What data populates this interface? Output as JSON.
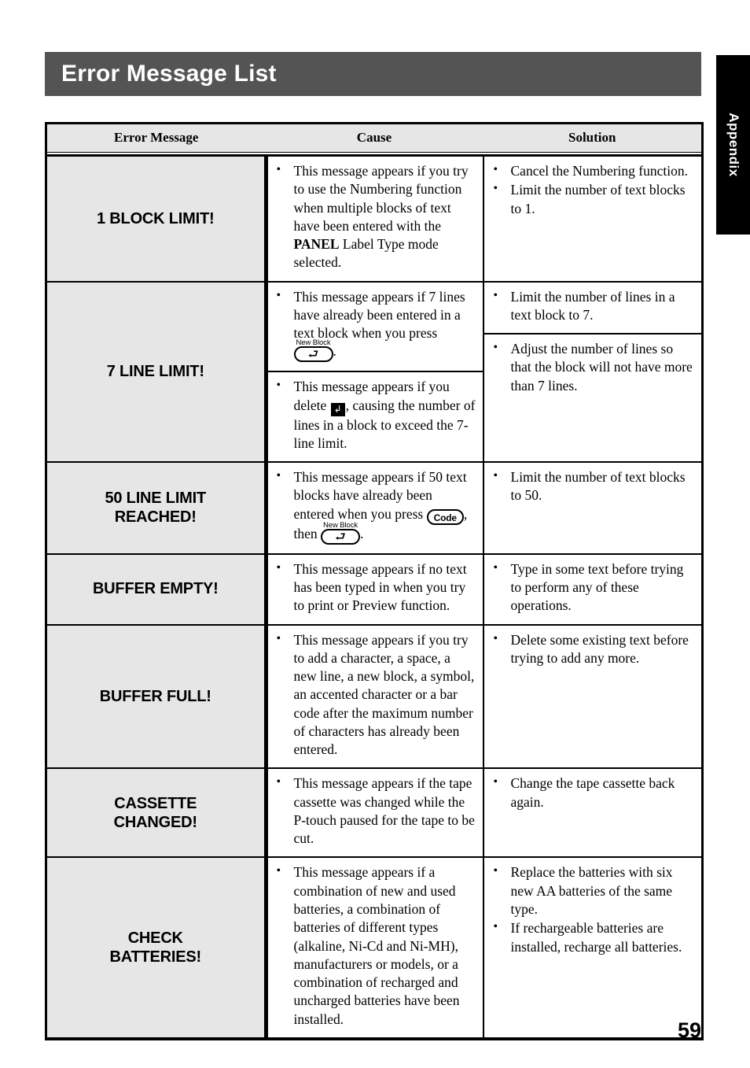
{
  "banner": {
    "title": "Error Message List"
  },
  "side_tab": {
    "label": "Appendix"
  },
  "page_number": "59",
  "table": {
    "headers": {
      "error_message": "Error Message",
      "cause": "Cause",
      "solution": "Solution"
    },
    "rows": [
      {
        "message": "1 BLOCK LIMIT!",
        "cause_blocks": [
          {
            "bullets": [
              {
                "parts": [
                  {
                    "t": "text",
                    "v": "This message appears if you try to use the Numbering function when multiple blocks of text have been entered with the "
                  },
                  {
                    "t": "bold",
                    "v": "PANEL"
                  },
                  {
                    "t": "text",
                    "v": " Label Type mode selected."
                  }
                ]
              }
            ]
          }
        ],
        "solution_bullets": [
          {
            "parts": [
              {
                "t": "text",
                "v": "Cancel the Numbering function."
              }
            ]
          },
          {
            "parts": [
              {
                "t": "text",
                "v": "Limit the number of text blocks to 1."
              }
            ]
          }
        ]
      },
      {
        "message": "7 LINE LIMIT!",
        "cause_blocks": [
          {
            "bullets": [
              {
                "parts": [
                  {
                    "t": "text",
                    "v": "This message appears if 7 lines have already been entered in a text block when you press "
                  },
                  {
                    "t": "key",
                    "label": "⮐",
                    "tag": "New Block",
                    "style": "wide"
                  },
                  {
                    "t": "text",
                    "v": "."
                  }
                ]
              }
            ]
          },
          {
            "bullets": [
              {
                "parts": [
                  {
                    "t": "text",
                    "v": "This message appears if you delete "
                  },
                  {
                    "t": "symbol",
                    "v": "↲"
                  },
                  {
                    "t": "text",
                    "v": ", causing the number of lines in a block to exceed the 7-line limit."
                  }
                ]
              }
            ]
          }
        ],
        "solution_blocks": [
          {
            "bullets": [
              {
                "parts": [
                  {
                    "t": "text",
                    "v": "Limit the number of lines in a text block to 7."
                  }
                ]
              }
            ]
          },
          {
            "bullets": [
              {
                "parts": [
                  {
                    "t": "text",
                    "v": "Adjust the number of lines so that the block will not have more than 7 lines."
                  }
                ]
              }
            ]
          }
        ]
      },
      {
        "message": "50 LINE LIMIT\nREACHED!",
        "cause_blocks": [
          {
            "bullets": [
              {
                "parts": [
                  {
                    "t": "text",
                    "v": "This message appears if 50 text blocks have already been entered when you press "
                  },
                  {
                    "t": "key",
                    "label": "Code",
                    "tag": "",
                    "style": "code"
                  },
                  {
                    "t": "text",
                    "v": ", then "
                  },
                  {
                    "t": "key",
                    "label": "⮐",
                    "tag": "New Block",
                    "style": "wide"
                  },
                  {
                    "t": "text",
                    "v": "."
                  }
                ]
              }
            ]
          }
        ],
        "solution_bullets": [
          {
            "parts": [
              {
                "t": "text",
                "v": "Limit the number of text blocks to 50."
              }
            ]
          }
        ]
      },
      {
        "message": "BUFFER EMPTY!",
        "cause_blocks": [
          {
            "bullets": [
              {
                "parts": [
                  {
                    "t": "text",
                    "v": "This message appears if no text has been typed in when you try to print or Preview function."
                  }
                ]
              }
            ]
          }
        ],
        "solution_bullets": [
          {
            "parts": [
              {
                "t": "text",
                "v": "Type in some text before trying to perform any of these operations."
              }
            ]
          }
        ]
      },
      {
        "message": "BUFFER FULL!",
        "cause_blocks": [
          {
            "bullets": [
              {
                "parts": [
                  {
                    "t": "text",
                    "v": "This message appears if you try to add a character, a space, a new line, a new block, a symbol, an accented character or a bar code after the maximum number of characters has already been entered."
                  }
                ]
              }
            ]
          }
        ],
        "solution_bullets": [
          {
            "parts": [
              {
                "t": "text",
                "v": "Delete some existing text before trying to add any more."
              }
            ]
          }
        ]
      },
      {
        "message": "CASSETTE\nCHANGED!",
        "cause_blocks": [
          {
            "bullets": [
              {
                "parts": [
                  {
                    "t": "text",
                    "v": "This message appears if the tape cassette was changed while the P-touch paused for the tape to be cut."
                  }
                ]
              }
            ]
          }
        ],
        "solution_bullets": [
          {
            "parts": [
              {
                "t": "text",
                "v": "Change the tape cassette back again."
              }
            ]
          }
        ]
      },
      {
        "message": "CHECK\nBATTERIES!",
        "cause_blocks": [
          {
            "bullets": [
              {
                "parts": [
                  {
                    "t": "text",
                    "v": "This message appears if a combination of new and used batteries, a combination of batteries of different types (alkaline, Ni-Cd and Ni-MH), manufacturers or models, or a combination of recharged and uncharged batteries have been installed."
                  }
                ]
              }
            ]
          }
        ],
        "solution_bullets": [
          {
            "parts": [
              {
                "t": "text",
                "v": "Replace the batteries with six new AA batteries of the same type."
              }
            ]
          },
          {
            "parts": [
              {
                "t": "text",
                "v": "If rechargeable batteries are installed, recharge all batteries."
              }
            ]
          }
        ]
      }
    ]
  },
  "colors": {
    "banner_bg": "#545454",
    "tab_bg": "#000000",
    "msg_cell_bg": "#e6e6e6",
    "header_cell_bg": "#e6e6e6"
  }
}
